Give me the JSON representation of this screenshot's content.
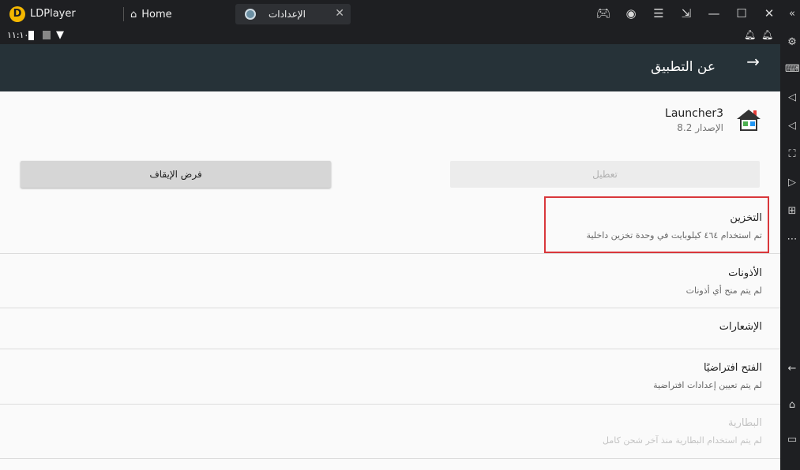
{
  "titlebar": {
    "brand": "LDPlayer",
    "tabs": [
      {
        "label": "Home"
      },
      {
        "label": "الإعدادات"
      }
    ]
  },
  "statusbar": {
    "time": "١١:١٠"
  },
  "appbar": {
    "title": "عن التطبيق"
  },
  "app_info": {
    "name": "Launcher3",
    "version": "الإصدار 8.2"
  },
  "buttons": {
    "force_stop": "فرض الإيقاف",
    "disable": "تعطيل"
  },
  "preferences": [
    {
      "title": "التخزين",
      "summary": "تم استخدام ٤٦٤ كيلوبايت في وحدة تخزين داخلية",
      "enabled": true,
      "highlighted": true
    },
    {
      "title": "الأذونات",
      "summary": "لم يتم منح أي أذونات",
      "enabled": true
    },
    {
      "title": "الإشعارات",
      "summary": "",
      "enabled": true
    },
    {
      "title": "الفتح افتراضيًا",
      "summary": "لم يتم تعيين إعدادات افتراضية",
      "enabled": true
    },
    {
      "title": "البطارية",
      "summary": "لم يتم استخدام البطارية منذ آخر شحن كامل",
      "enabled": false
    }
  ],
  "colors": {
    "appbar": "#263238",
    "highlight": "#d9373b",
    "brand": "#f5b800"
  }
}
